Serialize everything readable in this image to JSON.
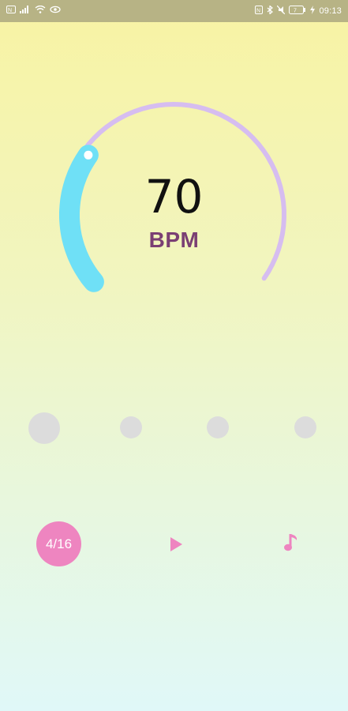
{
  "status_bar": {
    "time": "09:13",
    "left_icons": [
      "nfc-icon",
      "signal-icon",
      "wifi-icon",
      "eye-icon"
    ],
    "right_icons": [
      "nfc-icon",
      "bluetooth-icon",
      "mute-icon",
      "battery-icon",
      "charging-icon"
    ]
  },
  "tempo": {
    "value": "70",
    "unit": "BPM",
    "dial_level_fraction": 0.28,
    "track_color": "#d6bdf0",
    "fill_color": "#6fe0f6"
  },
  "beats": {
    "count": 4,
    "active_index": 0,
    "inactive_color": "#dcdcdc"
  },
  "controls": {
    "time_signature": "4/16",
    "play_icon": "play-icon",
    "sound_icon": "music-note-icon",
    "accent_color": "#ee85c0"
  }
}
